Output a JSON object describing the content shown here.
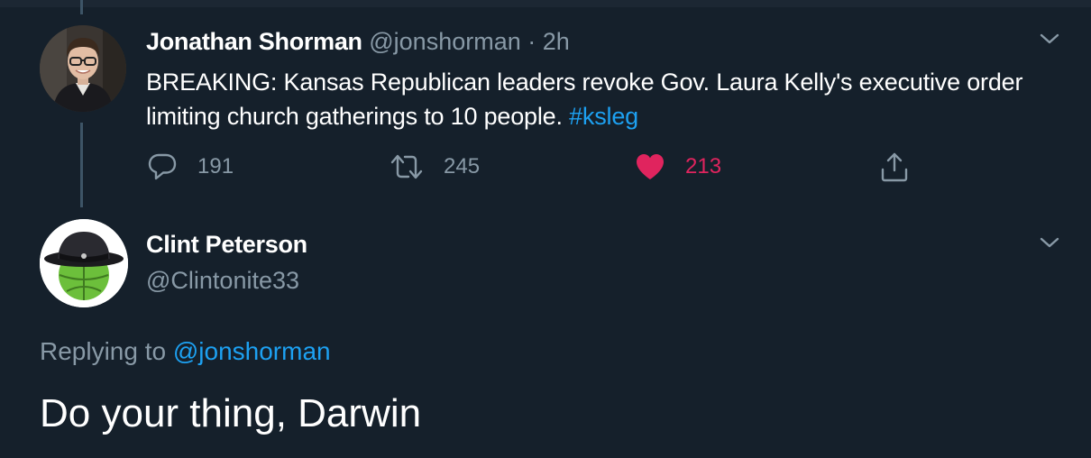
{
  "colors": {
    "background": "#15202b",
    "text_primary": "#ffffff",
    "text_muted": "#8899a6",
    "link": "#1da1f2",
    "like_active": "#e0245e",
    "thread_line": "#3d5466"
  },
  "original_tweet": {
    "author_name": "Jonathan Shorman",
    "author_handle": "@jonshorman",
    "separator": "·",
    "time": "2h",
    "text": "BREAKING: Kansas Republican leaders revoke Gov. Laura Kelly's executive order limiting church gatherings to 10 people.",
    "hashtag": "#ksleg",
    "avatar_icon": "profile-photo-icon",
    "menu_icon": "chevron-down-icon",
    "actions": {
      "reply": {
        "icon": "reply-icon",
        "count": "191"
      },
      "retweet": {
        "icon": "retweet-icon",
        "count": "245"
      },
      "like": {
        "icon": "heart-filled-icon",
        "count": "213",
        "active": true
      },
      "share": {
        "icon": "share-icon"
      }
    }
  },
  "reply_tweet": {
    "author_name": "Clint Peterson",
    "author_handle": "@Clintonite33",
    "avatar_icon": "green-ball-with-hat-avatar-icon",
    "menu_icon": "chevron-down-icon",
    "replying_label": "Replying to",
    "replying_to": "@jonshorman",
    "text": "Do your thing, Darwin"
  }
}
